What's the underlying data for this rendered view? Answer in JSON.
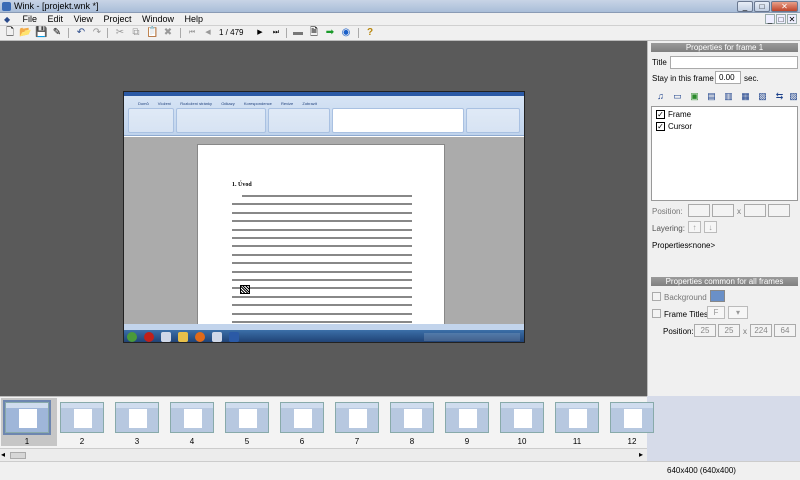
{
  "window": {
    "title": "Wink - [projekt.wnk *]",
    "min_glyph": "_",
    "max_glyph": "□",
    "close_glyph": "✕"
  },
  "menu": [
    {
      "label": "File"
    },
    {
      "label": "Edit"
    },
    {
      "label": "View"
    },
    {
      "label": "Project"
    },
    {
      "label": "Window"
    },
    {
      "label": "Help"
    }
  ],
  "mdi_controls": [
    "_",
    "□",
    "✕"
  ],
  "toolbar": {
    "frame_indicator": "1 / 479",
    "icons": [
      "new-icon",
      "open-icon",
      "save-icon",
      "render-icon",
      "undo-icon",
      "redo-icon",
      "cut-icon",
      "copy-icon",
      "paste-icon",
      "delete-icon",
      "first-frame-icon",
      "prev-frame-icon",
      "next-frame-icon",
      "last-frame-icon",
      "frame-props-icon",
      "page-icon",
      "go-icon",
      "browser-icon",
      "help-icon"
    ],
    "glyphs": {
      "new": "🗋",
      "open": "📂",
      "save": "💾",
      "render": "✎",
      "undo": "↶",
      "redo": "↷",
      "cut": "✂",
      "copy": "⧉",
      "paste": "📋",
      "delete": "✖",
      "first": "⏮",
      "prev": "◀",
      "next": "▶",
      "last": "⏭",
      "frame_props": "▬",
      "page": "🗎",
      "go": "➡",
      "browser": "◉",
      "help": "?"
    }
  },
  "screenshot": {
    "ribbon_tabs": [
      "Domů",
      "Vložení",
      "Rozložení stránky",
      "Odkazy",
      "Korespondence",
      "Revize",
      "Zobrazit"
    ],
    "heading": "1. Úvod",
    "accent": "#2b5aa6"
  },
  "properties": {
    "header": "Properties for frame 1",
    "title_label": "Title",
    "title_value": "",
    "stay_label": "Stay in this frame for",
    "stay_value": "0.00",
    "stay_unit": "sec.",
    "items": [
      {
        "label": "Frame",
        "checked": true
      },
      {
        "label": "Cursor",
        "checked": true
      }
    ],
    "position_label": "Position:",
    "position_sep": "x",
    "layering_label": "Layering:",
    "layer_up": "↑",
    "layer_down": "↓",
    "props_label": "Properties:",
    "props_value": "<none>",
    "check_glyph": "✓"
  },
  "common": {
    "header": "Properties common for all frames",
    "background_label": "Background",
    "frame_titles_label": "Frame Titles",
    "position_label": "Position:",
    "pos": [
      "25",
      "25",
      "224",
      "64"
    ],
    "position_sep": "x",
    "font_btn": "F",
    "combo_btn": "▾"
  },
  "thumbnails": [
    "1",
    "2",
    "3",
    "4",
    "5",
    "6",
    "7",
    "8",
    "9",
    "10",
    "11",
    "12"
  ],
  "scroll": {
    "left": "◂",
    "right": "▸"
  },
  "statusbar": {
    "text": "640x400 (640x400)"
  }
}
